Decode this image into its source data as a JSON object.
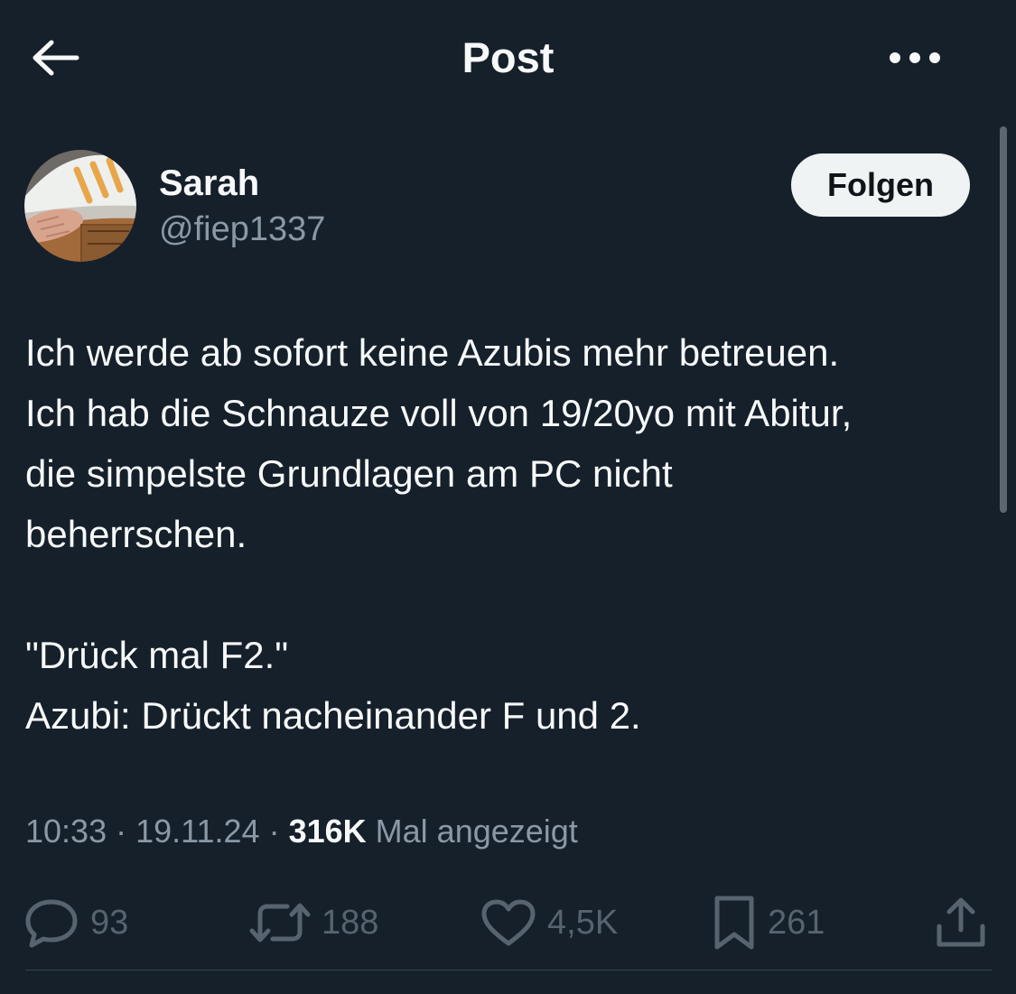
{
  "header": {
    "title": "Post",
    "back_icon": "arrow-left-icon",
    "more_icon": "more-horizontal-icon"
  },
  "author": {
    "name": "Sarah",
    "handle": "@fiep1337",
    "follow_label": "Folgen"
  },
  "post": {
    "lines": [
      "Ich werde ab sofort keine Azubis mehr betreuen.",
      "Ich hab die Schnauze voll von 19/20yo mit Abitur,",
      "die simpelste Grundlagen am PC nicht",
      "beherrschen.",
      "",
      "\"Drück mal F2.\"",
      "Azubi: Drückt nacheinander F und 2."
    ],
    "time": "10:33",
    "date": "19.11.24",
    "views": "316K",
    "views_label": "Mal angezeigt"
  },
  "actions": {
    "replies": "93",
    "reposts": "188",
    "likes": "4,5K",
    "bookmarks": "261"
  },
  "colors": {
    "background": "#15202b",
    "text_primary": "#f7f9f9",
    "text_secondary": "#8b98a5",
    "action_icon": "#57636e",
    "follow_bg": "#eff3f4"
  }
}
